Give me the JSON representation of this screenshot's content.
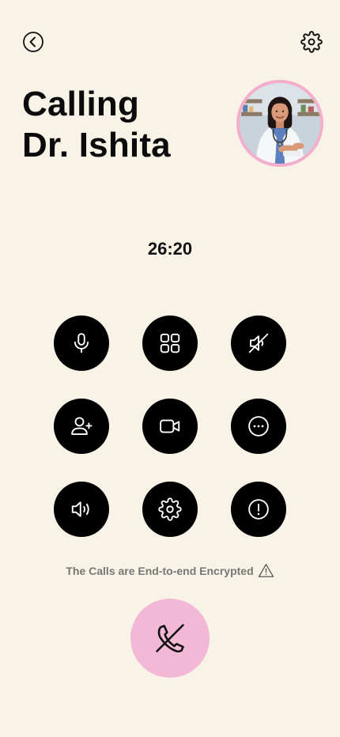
{
  "header": {
    "back_icon": "chevron-left-circle-icon",
    "settings_icon": "gear-icon"
  },
  "title": {
    "line1": "Calling",
    "line2": "Dr. Ishita"
  },
  "avatar": {
    "alt": "Dr. Ishita portrait",
    "ring_color": "#F2AECB"
  },
  "timer": "26:20",
  "controls": [
    {
      "id": "mic",
      "icon": "microphone-icon"
    },
    {
      "id": "keypad",
      "icon": "grid-icon"
    },
    {
      "id": "mute",
      "icon": "speaker-muted-icon"
    },
    {
      "id": "add-person",
      "icon": "user-plus-icon"
    },
    {
      "id": "video",
      "icon": "video-camera-icon"
    },
    {
      "id": "more",
      "icon": "more-dots-icon"
    },
    {
      "id": "speaker",
      "icon": "speaker-volume-icon"
    },
    {
      "id": "call-settings",
      "icon": "gear-icon"
    },
    {
      "id": "report",
      "icon": "alert-circle-icon"
    }
  ],
  "encryption_note": "The Calls are End-to-end Encrypted",
  "end_call": {
    "icon": "phone-off-icon",
    "color": "#F2B8D6"
  },
  "colors": {
    "background": "#F8F3E6",
    "button": "#000000",
    "text": "#0B0B0B"
  }
}
